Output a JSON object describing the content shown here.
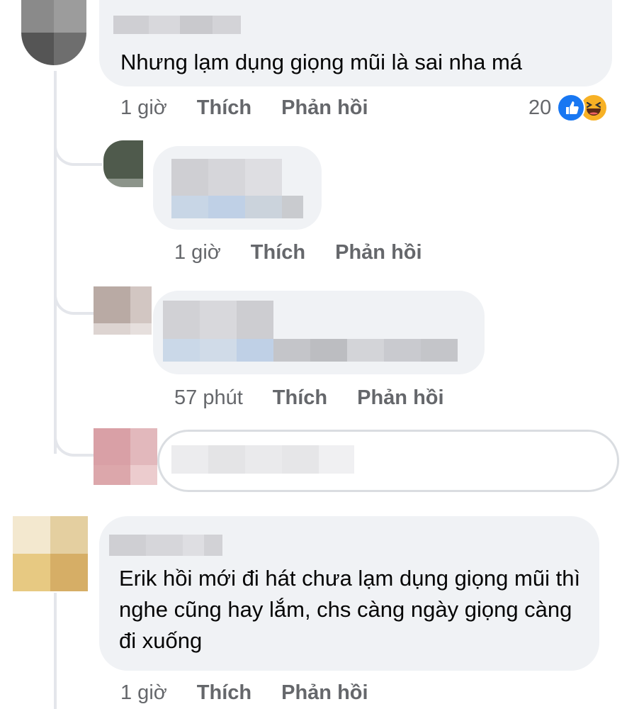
{
  "comments": [
    {
      "text": "Nhưng lạm dụng giọng mũi là sai nha má",
      "time": "1 giờ",
      "like_label": "Thích",
      "reply_label": "Phản hồi",
      "reaction_count": "20",
      "reactions": [
        "like-icon",
        "haha-icon"
      ],
      "replies": [
        {
          "time": "1 giờ",
          "like_label": "Thích",
          "reply_label": "Phản hồi"
        },
        {
          "time": "57 phút",
          "like_label": "Thích",
          "reply_label": "Phản hồi"
        }
      ]
    },
    {
      "text": "Erik hồi mới đi hát chưa lạm dụng giọng mũi thì nghe cũng hay lắm, chs càng ngày giọng càng đi xuống",
      "time": "1 giờ",
      "like_label": "Thích",
      "reply_label": "Phản hồi"
    }
  ],
  "colors": {
    "bubble": "#f0f2f5",
    "meta_text": "#65676b",
    "like_blue": "#1877f2",
    "haha_yellow": "#f7b125"
  }
}
